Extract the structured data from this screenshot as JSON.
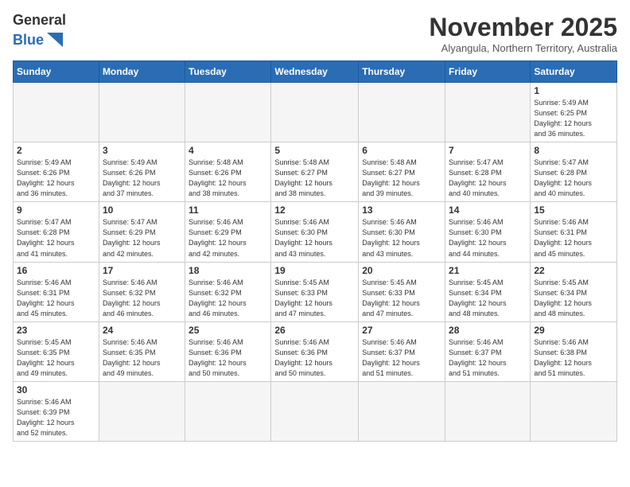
{
  "header": {
    "logo_general": "General",
    "logo_blue": "Blue",
    "month_title": "November 2025",
    "subtitle": "Alyangula, Northern Territory, Australia"
  },
  "weekdays": [
    "Sunday",
    "Monday",
    "Tuesday",
    "Wednesday",
    "Thursday",
    "Friday",
    "Saturday"
  ],
  "weeks": [
    [
      {
        "day": "",
        "info": ""
      },
      {
        "day": "",
        "info": ""
      },
      {
        "day": "",
        "info": ""
      },
      {
        "day": "",
        "info": ""
      },
      {
        "day": "",
        "info": ""
      },
      {
        "day": "",
        "info": ""
      },
      {
        "day": "1",
        "info": "Sunrise: 5:49 AM\nSunset: 6:25 PM\nDaylight: 12 hours\nand 36 minutes."
      }
    ],
    [
      {
        "day": "2",
        "info": "Sunrise: 5:49 AM\nSunset: 6:26 PM\nDaylight: 12 hours\nand 36 minutes."
      },
      {
        "day": "3",
        "info": "Sunrise: 5:49 AM\nSunset: 6:26 PM\nDaylight: 12 hours\nand 37 minutes."
      },
      {
        "day": "4",
        "info": "Sunrise: 5:48 AM\nSunset: 6:26 PM\nDaylight: 12 hours\nand 38 minutes."
      },
      {
        "day": "5",
        "info": "Sunrise: 5:48 AM\nSunset: 6:27 PM\nDaylight: 12 hours\nand 38 minutes."
      },
      {
        "day": "6",
        "info": "Sunrise: 5:48 AM\nSunset: 6:27 PM\nDaylight: 12 hours\nand 39 minutes."
      },
      {
        "day": "7",
        "info": "Sunrise: 5:47 AM\nSunset: 6:28 PM\nDaylight: 12 hours\nand 40 minutes."
      },
      {
        "day": "8",
        "info": "Sunrise: 5:47 AM\nSunset: 6:28 PM\nDaylight: 12 hours\nand 40 minutes."
      }
    ],
    [
      {
        "day": "9",
        "info": "Sunrise: 5:47 AM\nSunset: 6:28 PM\nDaylight: 12 hours\nand 41 minutes."
      },
      {
        "day": "10",
        "info": "Sunrise: 5:47 AM\nSunset: 6:29 PM\nDaylight: 12 hours\nand 42 minutes."
      },
      {
        "day": "11",
        "info": "Sunrise: 5:46 AM\nSunset: 6:29 PM\nDaylight: 12 hours\nand 42 minutes."
      },
      {
        "day": "12",
        "info": "Sunrise: 5:46 AM\nSunset: 6:30 PM\nDaylight: 12 hours\nand 43 minutes."
      },
      {
        "day": "13",
        "info": "Sunrise: 5:46 AM\nSunset: 6:30 PM\nDaylight: 12 hours\nand 43 minutes."
      },
      {
        "day": "14",
        "info": "Sunrise: 5:46 AM\nSunset: 6:30 PM\nDaylight: 12 hours\nand 44 minutes."
      },
      {
        "day": "15",
        "info": "Sunrise: 5:46 AM\nSunset: 6:31 PM\nDaylight: 12 hours\nand 45 minutes."
      }
    ],
    [
      {
        "day": "16",
        "info": "Sunrise: 5:46 AM\nSunset: 6:31 PM\nDaylight: 12 hours\nand 45 minutes."
      },
      {
        "day": "17",
        "info": "Sunrise: 5:46 AM\nSunset: 6:32 PM\nDaylight: 12 hours\nand 46 minutes."
      },
      {
        "day": "18",
        "info": "Sunrise: 5:46 AM\nSunset: 6:32 PM\nDaylight: 12 hours\nand 46 minutes."
      },
      {
        "day": "19",
        "info": "Sunrise: 5:45 AM\nSunset: 6:33 PM\nDaylight: 12 hours\nand 47 minutes."
      },
      {
        "day": "20",
        "info": "Sunrise: 5:45 AM\nSunset: 6:33 PM\nDaylight: 12 hours\nand 47 minutes."
      },
      {
        "day": "21",
        "info": "Sunrise: 5:45 AM\nSunset: 6:34 PM\nDaylight: 12 hours\nand 48 minutes."
      },
      {
        "day": "22",
        "info": "Sunrise: 5:45 AM\nSunset: 6:34 PM\nDaylight: 12 hours\nand 48 minutes."
      }
    ],
    [
      {
        "day": "23",
        "info": "Sunrise: 5:45 AM\nSunset: 6:35 PM\nDaylight: 12 hours\nand 49 minutes."
      },
      {
        "day": "24",
        "info": "Sunrise: 5:46 AM\nSunset: 6:35 PM\nDaylight: 12 hours\nand 49 minutes."
      },
      {
        "day": "25",
        "info": "Sunrise: 5:46 AM\nSunset: 6:36 PM\nDaylight: 12 hours\nand 50 minutes."
      },
      {
        "day": "26",
        "info": "Sunrise: 5:46 AM\nSunset: 6:36 PM\nDaylight: 12 hours\nand 50 minutes."
      },
      {
        "day": "27",
        "info": "Sunrise: 5:46 AM\nSunset: 6:37 PM\nDaylight: 12 hours\nand 51 minutes."
      },
      {
        "day": "28",
        "info": "Sunrise: 5:46 AM\nSunset: 6:37 PM\nDaylight: 12 hours\nand 51 minutes."
      },
      {
        "day": "29",
        "info": "Sunrise: 5:46 AM\nSunset: 6:38 PM\nDaylight: 12 hours\nand 51 minutes."
      }
    ],
    [
      {
        "day": "30",
        "info": "Sunrise: 5:46 AM\nSunset: 6:39 PM\nDaylight: 12 hours\nand 52 minutes."
      },
      {
        "day": "",
        "info": ""
      },
      {
        "day": "",
        "info": ""
      },
      {
        "day": "",
        "info": ""
      },
      {
        "day": "",
        "info": ""
      },
      {
        "day": "",
        "info": ""
      },
      {
        "day": "",
        "info": ""
      }
    ]
  ]
}
